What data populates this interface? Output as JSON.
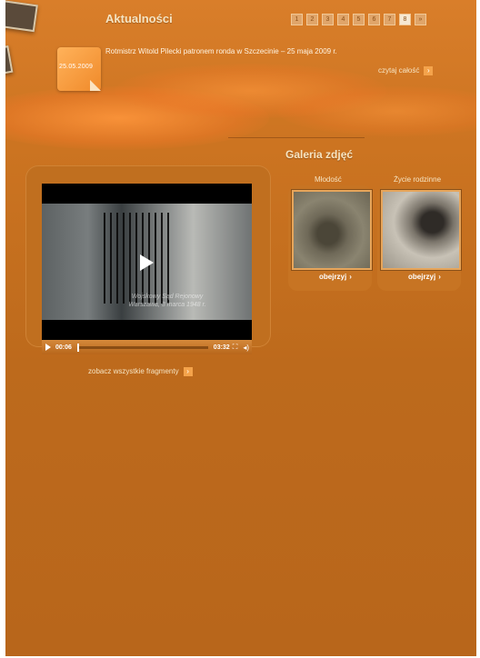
{
  "news": {
    "title": "Aktualności",
    "pages": [
      "1",
      "2",
      "3",
      "4",
      "5",
      "6",
      "7",
      "8",
      "»"
    ],
    "active_page": "8",
    "date": "25.05.2009",
    "headline": "Rotmistrz Witold Pilecki patronem ronda w Szczecinie – 25 maja 2009 r.",
    "read_more": "czytaj całość"
  },
  "video": {
    "caption_line1": "Wojskowy Sąd Rejonowy",
    "caption_line2": "Warszawa, 3 marca 1948 r.",
    "time_current": "00:06",
    "time_total": "03:32",
    "see_all": "zobacz wszystkie fragmenty"
  },
  "gallery": {
    "title": "Galeria zdjęć",
    "items": [
      {
        "label": "Młodość",
        "button": "obejrzyj"
      },
      {
        "label": "Życie rodzinne",
        "button": "obejrzyj"
      }
    ]
  },
  "icons": {
    "play": "play-icon",
    "fullscreen": "fullscreen-icon",
    "volume": "volume-icon",
    "chevron": "chevron-right-icon"
  },
  "colors": {
    "background": "#b8661b",
    "accent": "#f4a34b",
    "text_light": "#f6e4c2"
  }
}
